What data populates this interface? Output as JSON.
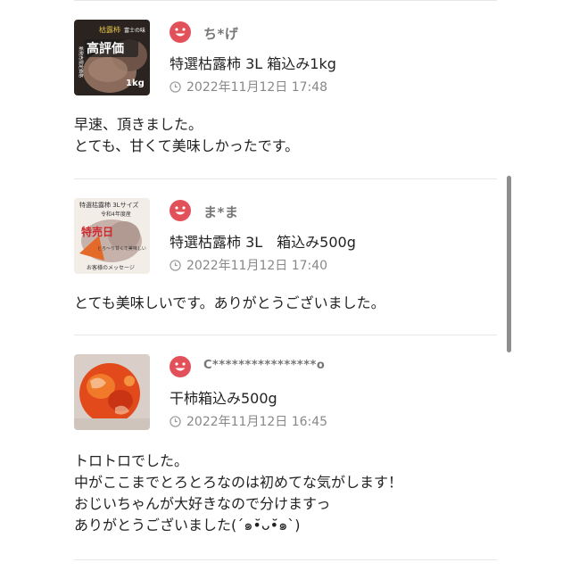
{
  "reviews": [
    {
      "user": "ち*げ",
      "product": "特選枯露柿 3L 箱込み1kg",
      "date": "2022年11月12日 17:48",
      "comment": "早速、頂きました。\nとても、甘くて美味しかったです。",
      "thumb": {
        "text_top": "枯露柿",
        "text_side": "富士の味",
        "text_main": "高評価",
        "text_left": "新発売限定価格",
        "text_weight": "1kg"
      }
    },
    {
      "user": "ま*ま",
      "product": "特選枯露柿 3L　箱込み500g",
      "date": "2022年11月12日 17:40",
      "comment": "とても美味しいです。ありがとうございました。",
      "thumb": {
        "text_top": "特選枯露柿 3Lサイズ",
        "text_year": "令和4年度産",
        "text_main": "特売日",
        "text_mid": "とろ〜り甘くて美味しい",
        "text_bottom": "お客様のメッセージ"
      }
    },
    {
      "user": "C****************o",
      "product": "干柿箱込み500g",
      "date": "2022年11月12日 16:45",
      "comment": "トロトロでした。\n中がここまでとろとろなのは初めてな気がします！\nおじいちゃんが大好きなので分けますっ\nありがとうございました(´๑•̆ᴗ•̆๑`)"
    }
  ],
  "colors": {
    "avatar": "#e2505a",
    "text": "#222222",
    "muted": "#888888",
    "divider": "#e6e6e6"
  },
  "icons": {
    "avatar": "smiley-face-icon",
    "date": "clock-icon"
  }
}
